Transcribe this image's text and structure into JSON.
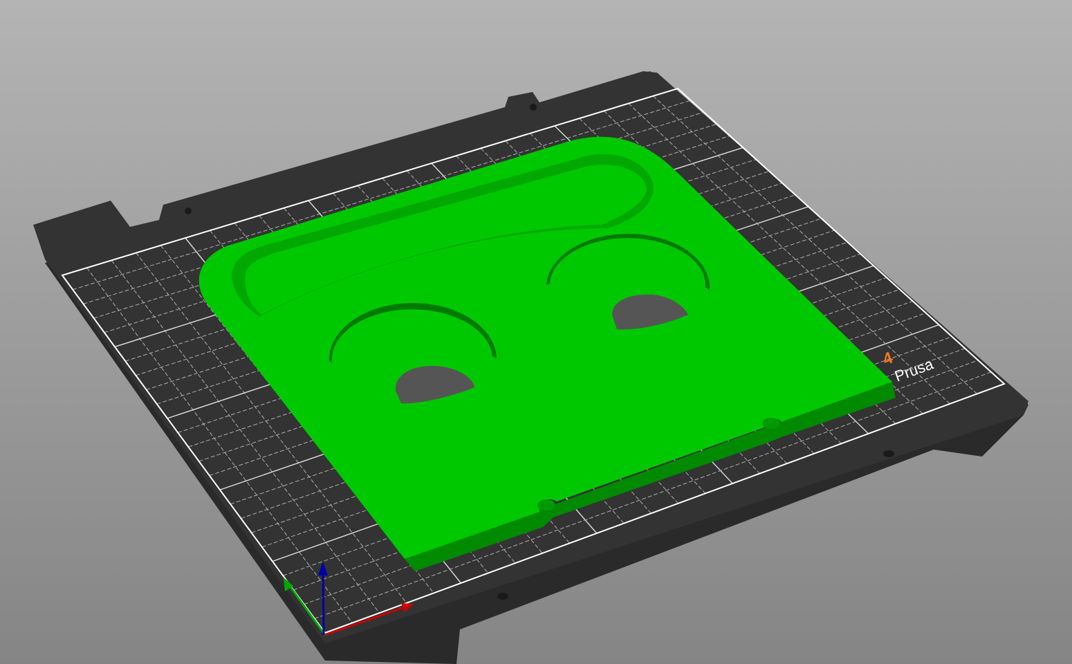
{
  "viewport": {
    "bed_logo_number": "4",
    "bed_logo_text": "Prusa",
    "colors": {
      "background_top": "#b4b4b4",
      "background_bottom": "#858585",
      "bed": "#333333",
      "grid": "#dddddd",
      "model": "#00c800",
      "model_shadow": "#008a00",
      "logo_accent": "#f07820",
      "axis_x": "#cc0000",
      "axis_y": "#00aa00",
      "axis_z": "#0000aa"
    },
    "axes": [
      "x-axis",
      "y-axis",
      "z-axis"
    ]
  }
}
